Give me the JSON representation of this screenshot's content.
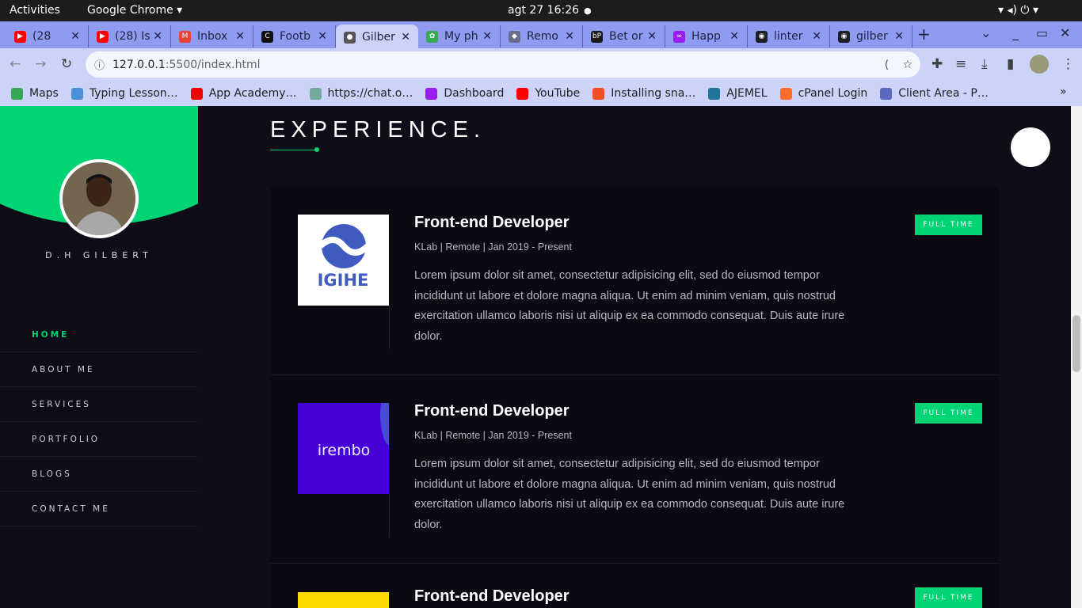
{
  "system": {
    "activities": "Activities",
    "app": "Google Chrome ▾",
    "datetime": "agt 27  16:26",
    "dot": "●",
    "status_icons": "▾  ◂)  ⏻ ▾"
  },
  "tabs": [
    {
      "title": "(28",
      "color": "#ff0000",
      "icon": "youtube-icon",
      "glyph": "▶"
    },
    {
      "title": "(28) Is",
      "color": "#ff0000",
      "icon": "youtube-icon",
      "glyph": "▶"
    },
    {
      "title": "Inbox",
      "color": "#ea4335",
      "icon": "gmail-icon",
      "glyph": "M"
    },
    {
      "title": "Footb",
      "color": "#111",
      "icon": "football-icon",
      "glyph": "C"
    },
    {
      "title": "Gilber",
      "color": "#555",
      "icon": "globe-icon",
      "glyph": "●",
      "active": true
    },
    {
      "title": "My ph",
      "color": "#34a853",
      "icon": "photos-icon",
      "glyph": "✿"
    },
    {
      "title": "Remo",
      "color": "#6b6b8a",
      "icon": "layers-icon",
      "glyph": "◆"
    },
    {
      "title": "Bet or",
      "color": "#1a1a1a",
      "icon": "bet-icon",
      "glyph": "bP"
    },
    {
      "title": "Happ",
      "color": "#9b1cf0",
      "icon": "happi-icon",
      "glyph": "∞"
    },
    {
      "title": "linter",
      "color": "#1b1f23",
      "icon": "github-icon",
      "glyph": "◉"
    },
    {
      "title": "gilber",
      "color": "#1b1f23",
      "icon": "github-icon",
      "glyph": "◉"
    }
  ],
  "window": {
    "new_tab": "+",
    "tab_search": "⌄",
    "minimize": "_",
    "maximize": "▭",
    "close": "✕"
  },
  "address": {
    "host": "127.0.0.1",
    "rest": ":5500/index.html"
  },
  "bookmarks": [
    {
      "label": "Maps",
      "color": "#34a853",
      "icon": "maps-icon"
    },
    {
      "label": "Typing Lesson…",
      "color": "#4a90d9",
      "icon": "typing-icon"
    },
    {
      "label": "App Academy…",
      "color": "#e00",
      "icon": "app-academy-icon"
    },
    {
      "label": "https://chat.o…",
      "color": "#74aa9c",
      "icon": "chatgpt-icon"
    },
    {
      "label": "Dashboard",
      "color": "#9b1cf0",
      "icon": "dashboard-icon"
    },
    {
      "label": "YouTube",
      "color": "#ff0000",
      "icon": "youtube-icon"
    },
    {
      "label": "Installing sna…",
      "color": "#f04e23",
      "icon": "snap-icon"
    },
    {
      "label": "AJEMEL",
      "color": "#21759b",
      "icon": "wordpress-icon"
    },
    {
      "label": "cPanel Login",
      "color": "#ff6c2c",
      "icon": "cpanel-icon"
    },
    {
      "label": "Client Area - P…",
      "color": "#5a6bbf",
      "icon": "client-area-icon"
    }
  ],
  "bookmarks_more": "»",
  "sidebar": {
    "name": "D.H GILBERT",
    "nav": [
      "HOME",
      "ABOUT ME",
      "SERVICES",
      "PORTFOLIO",
      "BLOGS",
      "CONTACT ME"
    ],
    "active": 0
  },
  "section": {
    "title": "EXPERIENCE."
  },
  "accent": "#00d474",
  "experience": [
    {
      "title": "Front-end Developer",
      "meta": "KLab | Remote | Jan 2019 - Present",
      "badge": "FULL TIME",
      "logo": "IGIHE",
      "desc": "Lorem ipsum dolor sit amet, consectetur adipisicing elit, sed do eiusmod tempor incididunt ut labore et dolore magna aliqua. Ut enim ad minim veniam, quis nostrud exercitation ullamco laboris nisi ut aliquip ex ea commodo consequat. Duis aute irure dolor."
    },
    {
      "title": "Front-end Developer",
      "meta": "KLab | Remote | Jan 2019 - Present",
      "badge": "FULL TIME",
      "logo": "irembo",
      "desc": "Lorem ipsum dolor sit amet, consectetur adipisicing elit, sed do eiusmod tempor incididunt ut labore et dolore magna aliqua. Ut enim ad minim veniam, quis nostrud exercitation ullamco laboris nisi ut aliquip ex ea commodo consequat. Duis aute irure dolor."
    },
    {
      "title": "Front-end Developer",
      "meta": "",
      "badge": "FULL TIME",
      "logo": "",
      "desc": ""
    }
  ]
}
